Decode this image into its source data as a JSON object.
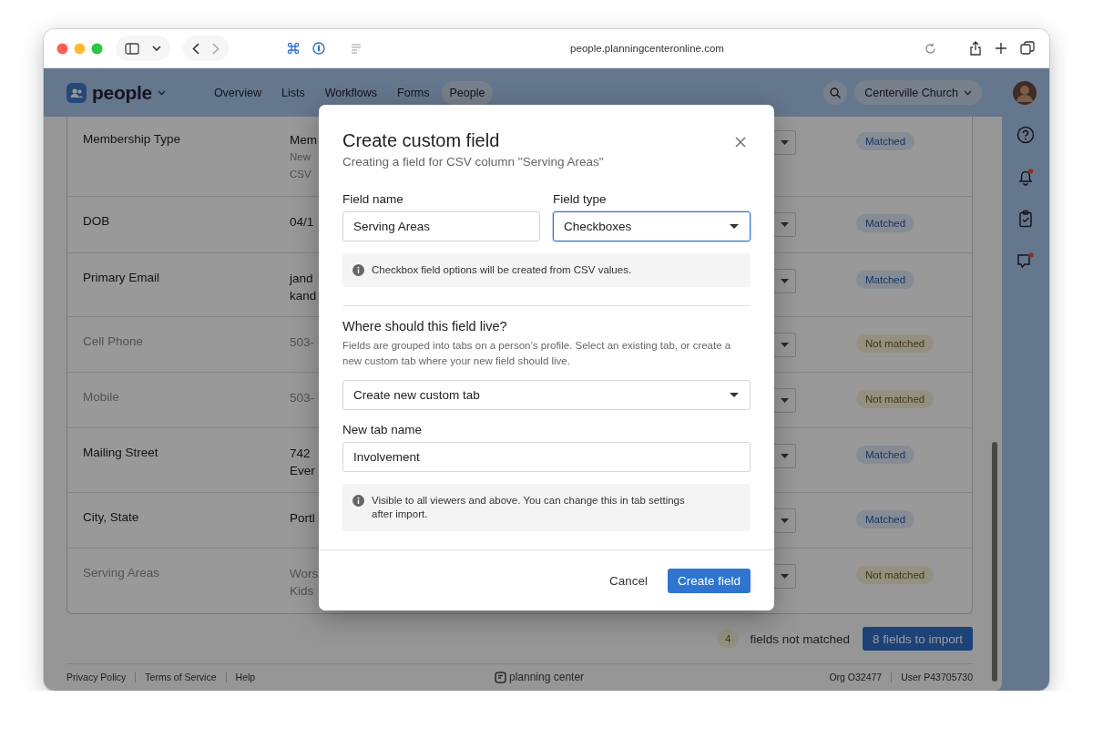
{
  "browser": {
    "url": "people.planningcenteronline.com"
  },
  "app": {
    "name": "people",
    "nav": [
      {
        "label": "Overview",
        "selected": false
      },
      {
        "label": "Lists",
        "selected": false
      },
      {
        "label": "Workflows",
        "selected": false
      },
      {
        "label": "Forms",
        "selected": false
      },
      {
        "label": "People",
        "selected": true
      }
    ],
    "org": "Centerville Church"
  },
  "table": {
    "rows": [
      {
        "field": "Membership Type",
        "muted": false,
        "value_lines": [
          "Mem"
        ],
        "note_lines": [
          "New",
          "CSV"
        ],
        "status": "Matched",
        "matched": true
      },
      {
        "field": "DOB",
        "muted": false,
        "value_lines": [
          "04/1"
        ],
        "status": "Matched",
        "matched": true
      },
      {
        "field": "Primary Email",
        "muted": false,
        "value_lines": [
          "jand",
          "kand"
        ],
        "status": "Matched",
        "matched": true
      },
      {
        "field": "Cell Phone",
        "muted": true,
        "value_lines": [
          "503-"
        ],
        "status": "Not matched",
        "matched": false
      },
      {
        "field": "Mobile",
        "muted": true,
        "value_lines": [
          "503-"
        ],
        "status": "Not matched",
        "matched": false
      },
      {
        "field": "Mailing Street",
        "muted": false,
        "value_lines": [
          "742",
          "Ever"
        ],
        "status": "Matched",
        "matched": true
      },
      {
        "field": "City, State",
        "muted": false,
        "value_lines": [
          "Portl"
        ],
        "status": "Matched",
        "matched": true
      },
      {
        "field": "Serving Areas",
        "muted": true,
        "value_lines": [
          "Wors",
          "Kids"
        ],
        "status": "Not matched",
        "matched": false
      }
    ]
  },
  "summary": {
    "unmatched_count": "4",
    "unmatched_label": "fields not matched",
    "import_button": "8 fields to import"
  },
  "footer": {
    "links": [
      "Privacy Policy",
      "Terms of Service",
      "Help"
    ],
    "brand": "planning center",
    "org": "Org O32477",
    "user": "User P43705730"
  },
  "modal": {
    "title": "Create custom field",
    "subtitle": "Creating a field for CSV column \"Serving Areas\"",
    "field_name": {
      "label": "Field name",
      "value": "Serving Areas"
    },
    "field_type": {
      "label": "Field type",
      "value": "Checkboxes",
      "focused": true
    },
    "type_info": "Checkbox field options will be created from CSV values.",
    "section_title": "Where should this field live?",
    "section_description": "Fields are grouped into tabs on a person’s profile. Select an existing tab, or create a new custom tab where your new field should live.",
    "tab_select": {
      "value": "Create new custom tab"
    },
    "new_tab": {
      "label": "New tab name",
      "value": "Involvement"
    },
    "visibility_info": "Visible to all viewers and above. You can change this in tab settings after import.",
    "cancel": "Cancel",
    "submit": "Create field"
  }
}
